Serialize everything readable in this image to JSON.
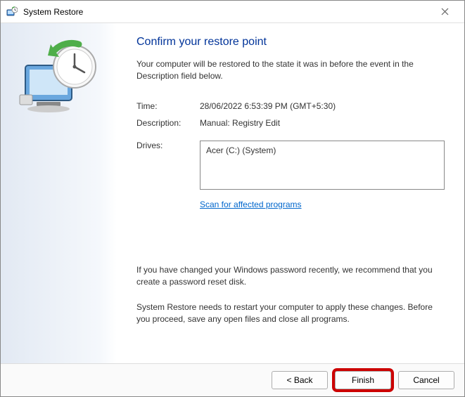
{
  "titlebar": {
    "title": "System Restore"
  },
  "main": {
    "heading": "Confirm your restore point",
    "description": "Your computer will be restored to the state it was in before the event in the Description field below.",
    "fields": {
      "time_label": "Time:",
      "time_value": "28/06/2022 6:53:39 PM (GMT+5:30)",
      "desc_label": "Description:",
      "desc_value": "Manual: Registry Edit",
      "drives_label": "Drives:",
      "drives_value": "Acer (C:) (System)"
    },
    "scan_link": "Scan for affected programs",
    "notice1": "If you have changed your Windows password recently, we recommend that you create a password reset disk.",
    "notice2": "System Restore needs to restart your computer to apply these changes. Before you proceed, save any open files and close all programs."
  },
  "footer": {
    "back": "< Back",
    "finish": "Finish",
    "cancel": "Cancel"
  }
}
